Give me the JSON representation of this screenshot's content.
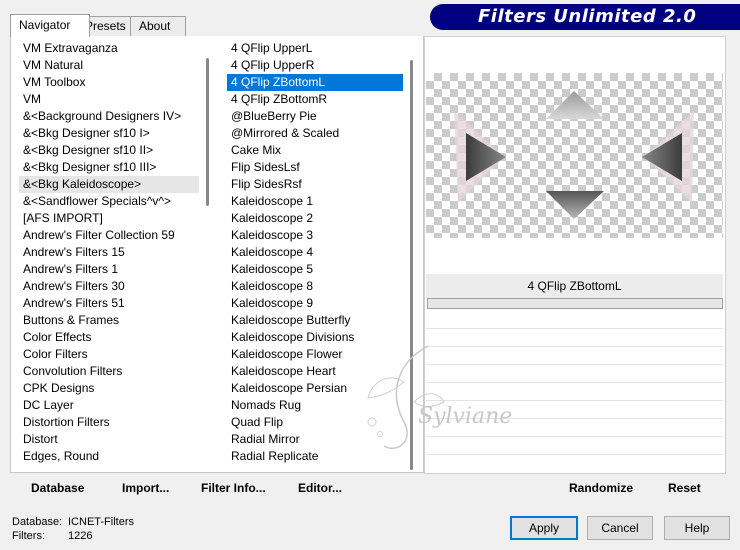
{
  "tabs": [
    {
      "label": "Navigator"
    },
    {
      "label": "Presets"
    },
    {
      "label": "About"
    }
  ],
  "title": "Filters Unlimited 2.0",
  "left_list": [
    "VM Extravaganza",
    "VM Natural",
    "VM Toolbox",
    "VM",
    "&<Background Designers IV>",
    "&<Bkg Designer sf10 I>",
    "&<Bkg Designer sf10 II>",
    "&<Bkg Designer sf10 III>",
    "&<Bkg Kaleidoscope>",
    "&<Sandflower Specials^v^>",
    "[AFS IMPORT]",
    "Andrew's Filter Collection 59",
    "Andrew's Filters 15",
    "Andrew's Filters 1",
    "Andrew's Filters 30",
    "Andrew's Filters 51",
    "Buttons & Frames",
    "Color Effects",
    "Color Filters",
    "Convolution Filters",
    "CPK Designs",
    "DC Layer",
    "Distortion Filters",
    "Distort",
    "Edges, Round"
  ],
  "left_list_highlight_index": 8,
  "right_list": [
    "4 QFlip UpperL",
    "4 QFlip UpperR",
    "4 QFlip ZBottomL",
    "4 QFlip ZBottomR",
    "@BlueBerry Pie",
    "@Mirrored & Scaled",
    "Cake Mix",
    "Flip SidesLsf",
    "Flip SidesRsf",
    "Kaleidoscope 1",
    "Kaleidoscope 2",
    "Kaleidoscope 3",
    "Kaleidoscope 4",
    "Kaleidoscope 5",
    "Kaleidoscope 8",
    "Kaleidoscope 9",
    "Kaleidoscope Butterfly",
    "Kaleidoscope Divisions",
    "Kaleidoscope Flower",
    "Kaleidoscope Heart",
    "Kaleidoscope Persian",
    "Nomads Rug",
    "Quad Flip",
    "Radial Mirror",
    "Radial Replicate"
  ],
  "right_list_selected_index": 2,
  "preview": {
    "filter_name": "4 QFlip ZBottomL"
  },
  "links": {
    "database": "Database",
    "import": "Import...",
    "filter_info": "Filter Info...",
    "editor": "Editor...",
    "randomize": "Randomize",
    "reset": "Reset"
  },
  "status": {
    "database_label": "Database:",
    "database_value": "ICNET-Filters",
    "filters_label": "Filters:",
    "filters_value": "1226"
  },
  "buttons": {
    "apply": "Apply",
    "cancel": "Cancel",
    "help": "Help"
  },
  "watermark": "Sylviane",
  "colors": {
    "title_bar": "#000080",
    "selection": "#0078d7"
  }
}
